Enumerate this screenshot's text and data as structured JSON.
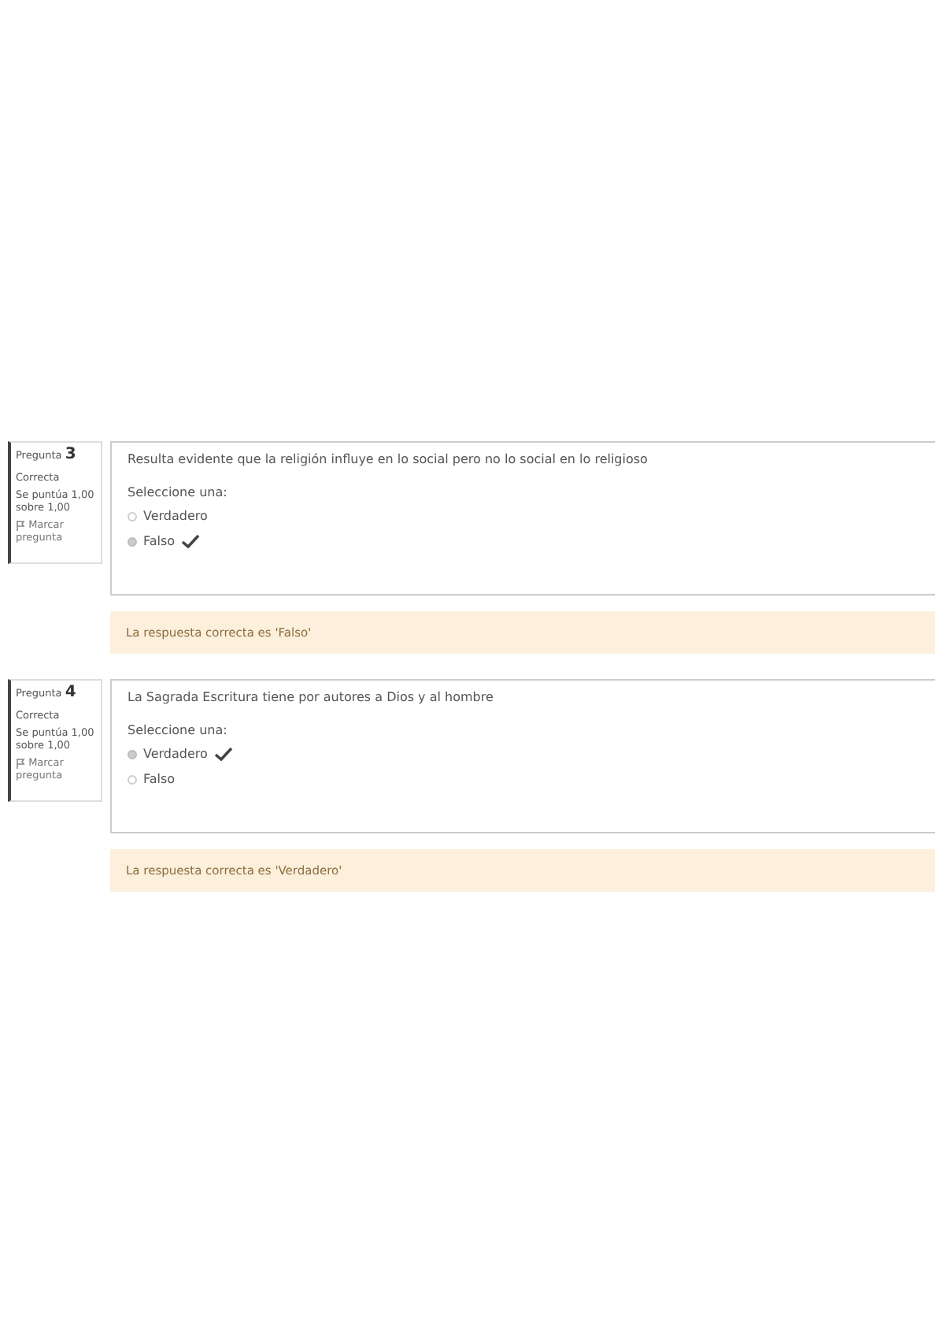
{
  "questions": [
    {
      "label": "Pregunta",
      "number": "3",
      "state": "Correcta",
      "grade": "Se puntúa 1,00 sobre 1,00",
      "flag": "Marcar pregunta",
      "text": "Resulta evidente que la religión influye en lo social pero no lo social en lo religioso",
      "prompt": "Seleccione una:",
      "options": [
        {
          "label": "Verdadero",
          "selected": false,
          "correct": false
        },
        {
          "label": "Falso",
          "selected": true,
          "correct": true
        }
      ],
      "feedback": "La respuesta correcta es 'Falso'"
    },
    {
      "label": "Pregunta",
      "number": "4",
      "state": "Correcta",
      "grade": "Se puntúa 1,00 sobre 1,00",
      "flag": "Marcar pregunta",
      "text": "La Sagrada Escritura tiene por autores a Dios y al hombre",
      "prompt": "Seleccione una:",
      "options": [
        {
          "label": "Verdadero",
          "selected": true,
          "correct": true
        },
        {
          "label": "Falso",
          "selected": false,
          "correct": false
        }
      ],
      "feedback": "La respuesta correcta es 'Verdadero'"
    }
  ]
}
